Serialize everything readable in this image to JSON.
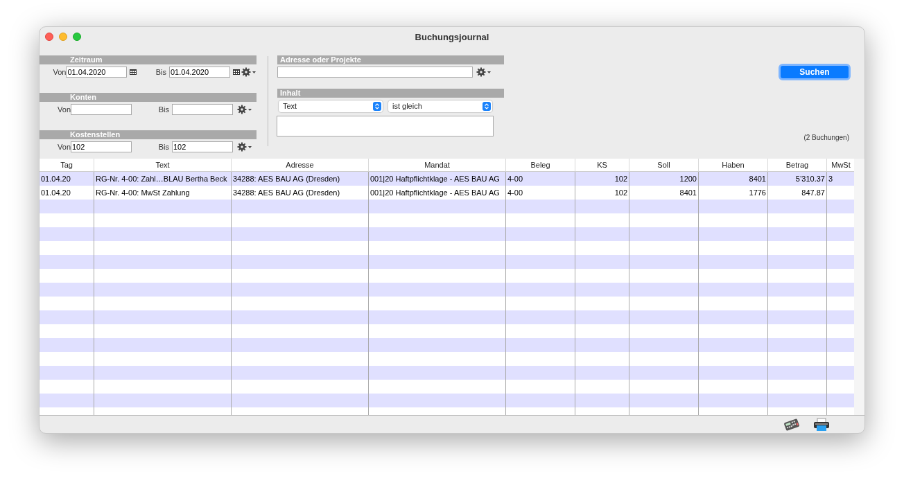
{
  "window": {
    "title": "Buchungsjournal"
  },
  "ranges": [
    {
      "title": "Zeitraum",
      "kind": "date",
      "from": {
        "label": "Von",
        "value": "01.04.2020"
      },
      "to": {
        "label": "Bis",
        "value": "01.04.2020"
      }
    },
    {
      "title": "Konten",
      "kind": "text",
      "from": {
        "label": "Von"
      },
      "to": {
        "label": "Bis"
      }
    },
    {
      "title": "Kostenstellen",
      "kind": "text",
      "from": {
        "label": "Von",
        "value": "102"
      },
      "to": {
        "label": "Bis",
        "value": "102"
      }
    }
  ],
  "address": {
    "title": "Adresse oder Projekte"
  },
  "content": {
    "title": "Inhalt",
    "selects": [
      "Text",
      "ist gleich"
    ]
  },
  "search_button": "Suchen",
  "result_count": "(2 Buchungen)",
  "table": {
    "columns": [
      {
        "label": "Tag"
      },
      {
        "label": "Text"
      },
      {
        "label": "Adresse"
      },
      {
        "label": "Mandat"
      },
      {
        "label": "Beleg"
      },
      {
        "label": "KS"
      },
      {
        "label": "Soll"
      },
      {
        "label": "Haben"
      },
      {
        "label": "Betrag"
      },
      {
        "label": "MwSt"
      }
    ],
    "rows": [
      [
        "01.04.20",
        "RG-Nr. 4-00: Zahl…BLAU Bertha Beck",
        "34288: AES BAU AG (Dresden)",
        "001|20 Haftpflichtklage - AES BAU AG",
        "4-00",
        "102",
        "1200",
        "8401",
        "5’310.37",
        "3"
      ],
      [
        "01.04.20",
        "RG-Nr. 4-00: MwSt Zahlung",
        "34288: AES BAU AG (Dresden)",
        "001|20 Haftpflichtklage - AES BAU AG",
        "4-00",
        "102",
        "8401",
        "1776",
        "847.87",
        ""
      ]
    ]
  }
}
